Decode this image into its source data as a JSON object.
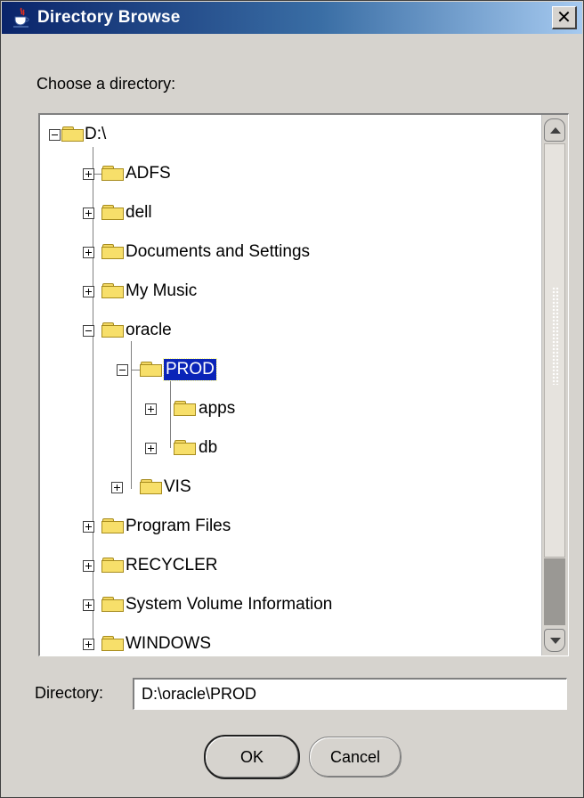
{
  "window": {
    "title": "Directory Browse",
    "close_glyph": "✕",
    "icon": "java-cup-icon"
  },
  "prompt": "Choose a directory:",
  "tree": {
    "root": "D:\\",
    "items": [
      {
        "label": "ADFS"
      },
      {
        "label": "dell"
      },
      {
        "label": "Documents and Settings"
      },
      {
        "label": "My Music"
      },
      {
        "label": "oracle"
      },
      {
        "label": "PROD"
      },
      {
        "label": "apps"
      },
      {
        "label": "db"
      },
      {
        "label": "VIS"
      },
      {
        "label": "Program Files"
      },
      {
        "label": "RECYCLER"
      },
      {
        "label": "System Volume Information"
      },
      {
        "label": "WINDOWS"
      }
    ],
    "selected": "PROD"
  },
  "directory": {
    "label": "Directory:",
    "value": "D:\\oracle\\PROD"
  },
  "buttons": {
    "ok": "OK",
    "cancel": "Cancel"
  },
  "colors": {
    "title_bar_start": "#0a246a",
    "title_bar_end": "#a6caf0",
    "dialog_bg": "#d6d3ce",
    "selection": "#0a24b8",
    "folder": "#f7df6a"
  }
}
